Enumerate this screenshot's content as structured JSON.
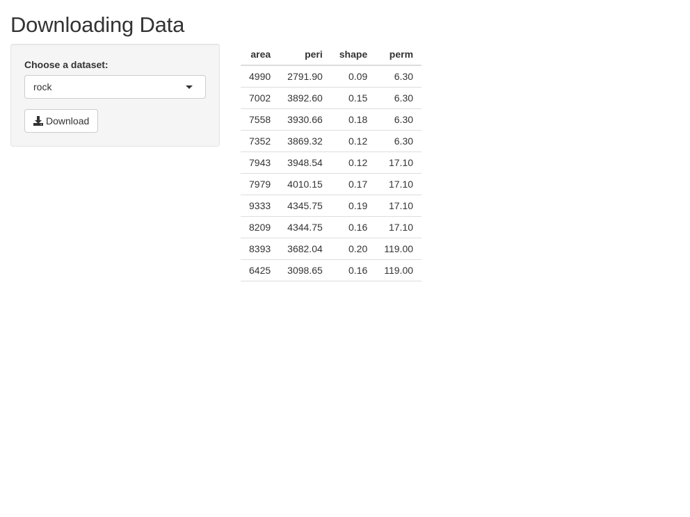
{
  "page": {
    "title": "Downloading Data"
  },
  "sidebar": {
    "dataset_label": "Choose a dataset:",
    "dataset_selected": "rock",
    "download_label": "Download",
    "download_icon": "download-icon"
  },
  "table": {
    "columns": [
      "area",
      "peri",
      "shape",
      "perm"
    ],
    "rows": [
      [
        "4990",
        "2791.90",
        "0.09",
        "6.30"
      ],
      [
        "7002",
        "3892.60",
        "0.15",
        "6.30"
      ],
      [
        "7558",
        "3930.66",
        "0.18",
        "6.30"
      ],
      [
        "7352",
        "3869.32",
        "0.12",
        "6.30"
      ],
      [
        "7943",
        "3948.54",
        "0.12",
        "17.10"
      ],
      [
        "7979",
        "4010.15",
        "0.17",
        "17.10"
      ],
      [
        "9333",
        "4345.75",
        "0.19",
        "17.10"
      ],
      [
        "8209",
        "4344.75",
        "0.16",
        "17.10"
      ],
      [
        "8393",
        "3682.04",
        "0.20",
        "119.00"
      ],
      [
        "6425",
        "3098.65",
        "0.16",
        "119.00"
      ]
    ]
  },
  "colors": {
    "text": "#333333",
    "panel_bg": "#f5f5f5",
    "panel_border": "#e3e3e3",
    "table_border": "#dddddd"
  }
}
